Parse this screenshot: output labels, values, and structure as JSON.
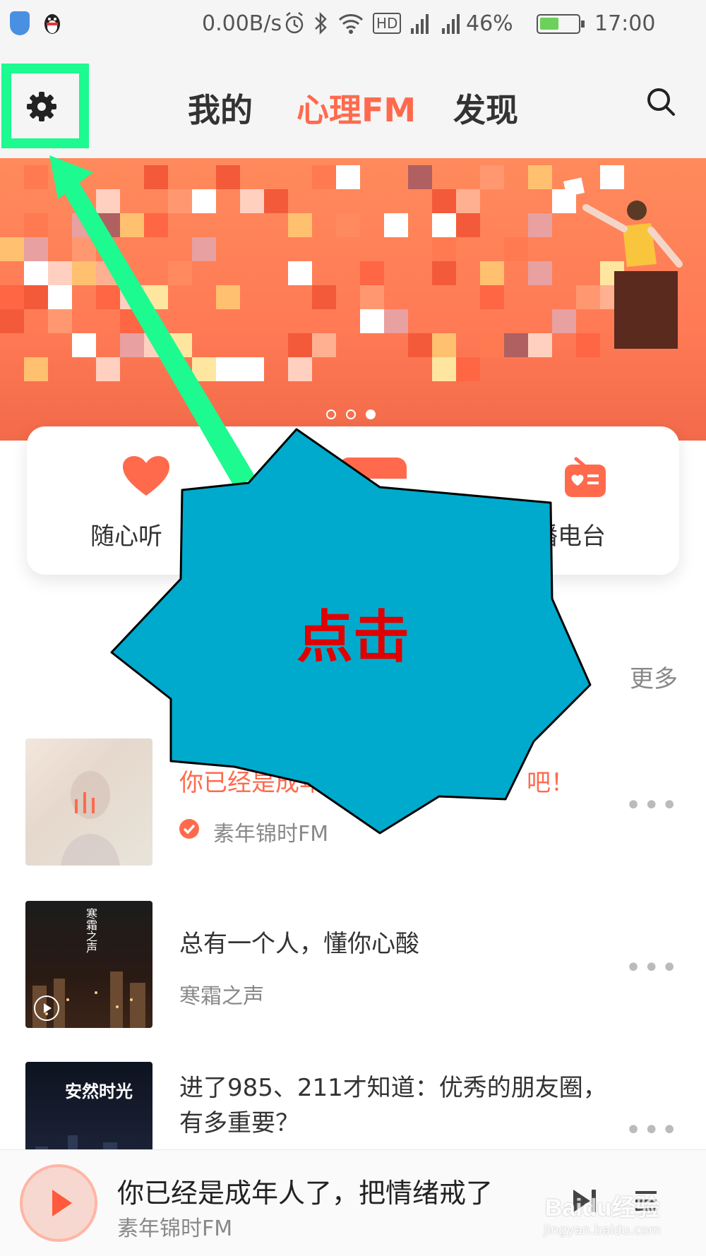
{
  "status_bar": {
    "net_speed": "0.00B/s",
    "hd": "HD",
    "battery": "46%",
    "time": "17:00"
  },
  "header": {
    "tabs": [
      {
        "label": "我的",
        "active": false
      },
      {
        "label": "心理FM",
        "active": true
      },
      {
        "label": "发现",
        "active": false
      }
    ]
  },
  "banner": {
    "page_count": 3,
    "current_page": 3
  },
  "categories": [
    {
      "label": "随心听",
      "icon": "heart-icon"
    },
    {
      "label": "",
      "icon": "category-icon"
    },
    {
      "label": "播电台",
      "icon": "radio-icon"
    }
  ],
  "annotation": {
    "text": "点击",
    "color": "#e00000",
    "burst_color": "#00aacc",
    "highlight_color": "#1dfa8f"
  },
  "section": {
    "more_label": "更多"
  },
  "list": [
    {
      "title_start": "你已经是成年",
      "title_end": "吧！",
      "author": "素年锦时FM",
      "playing": true,
      "verified": true
    },
    {
      "title": "总有一个人，懂你心酸",
      "author": "寒霜之声",
      "playing": false
    },
    {
      "title": "进了985、211才知道：优秀的朋友圈，有多重要？",
      "author": "",
      "playing": false
    }
  ],
  "thumb_text": {
    "item2": "寒霜之声",
    "item3": "安然时光"
  },
  "player": {
    "title": "你已经是成年人了，把情绪戒了",
    "author": "素年锦时FM"
  },
  "watermark": {
    "text": "Baidu经验",
    "url": "jingyan.baidu.com"
  },
  "colors": {
    "accent": "#ff6a4d",
    "header_bg": "#f5f5f5"
  }
}
